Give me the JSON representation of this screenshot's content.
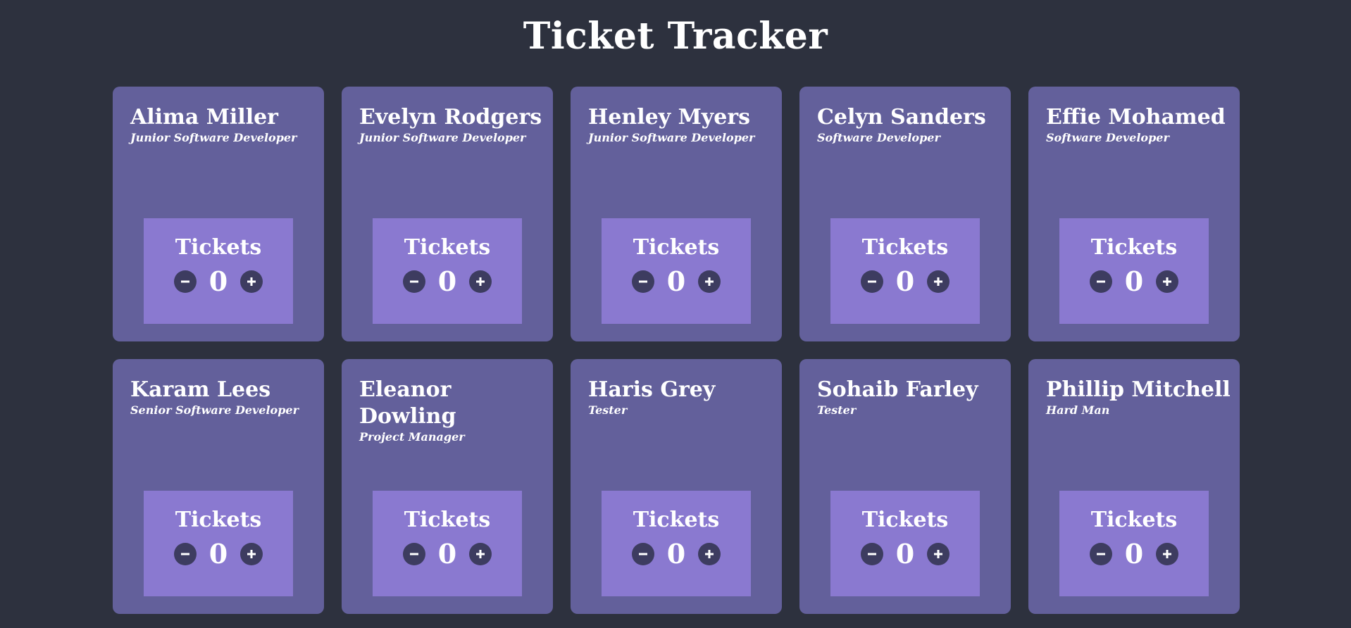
{
  "page": {
    "title": "Ticket Tracker"
  },
  "people": [
    {
      "name": "Alima Miller",
      "role": "Junior Software Developer",
      "tickets_label": "Tickets",
      "count": "0"
    },
    {
      "name": "Evelyn Rodgers",
      "role": "Junior Software Developer",
      "tickets_label": "Tickets",
      "count": "0"
    },
    {
      "name": "Henley Myers",
      "role": "Junior Software Developer",
      "tickets_label": "Tickets",
      "count": "0"
    },
    {
      "name": "Celyn Sanders",
      "role": "Software Developer",
      "tickets_label": "Tickets",
      "count": "0"
    },
    {
      "name": "Effie Mohamed",
      "role": "Software Developer",
      "tickets_label": "Tickets",
      "count": "0"
    },
    {
      "name": "Karam Lees",
      "role": "Senior Software Developer",
      "tickets_label": "Tickets",
      "count": "0"
    },
    {
      "name": "Eleanor Dowling",
      "role": "Project Manager",
      "tickets_label": "Tickets",
      "count": "0"
    },
    {
      "name": "Haris Grey",
      "role": "Tester",
      "tickets_label": "Tickets",
      "count": "0"
    },
    {
      "name": "Sohaib Farley",
      "role": "Tester",
      "tickets_label": "Tickets",
      "count": "0"
    },
    {
      "name": "Phillip Mitchell",
      "role": "Hard Man",
      "tickets_label": "Tickets",
      "count": "0"
    }
  ],
  "icons": {
    "decrement": "minus-icon",
    "increment": "plus-icon"
  },
  "colors": {
    "background": "#2d313e",
    "card": "#63609b",
    "tickets_box": "#8a79d0",
    "button": "#3d3c60",
    "text": "#ffffff"
  }
}
